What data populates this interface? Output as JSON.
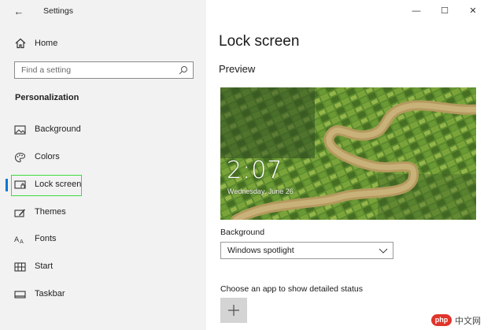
{
  "window": {
    "title": "Settings",
    "back_glyph": "←",
    "controls": {
      "minimize": "—",
      "maximize": "☐",
      "close": "✕"
    }
  },
  "sidebar": {
    "home_label": "Home",
    "search_placeholder": "Find a setting",
    "section_title": "Personalization",
    "items": [
      {
        "label": "Background",
        "icon": "picture-icon"
      },
      {
        "label": "Colors",
        "icon": "palette-icon"
      },
      {
        "label": "Lock screen",
        "icon": "lock-screen-icon",
        "active": true
      },
      {
        "label": "Themes",
        "icon": "brush-icon"
      },
      {
        "label": "Fonts",
        "icon": "fonts-icon"
      },
      {
        "label": "Start",
        "icon": "start-menu-icon"
      },
      {
        "label": "Taskbar",
        "icon": "taskbar-icon"
      }
    ]
  },
  "main": {
    "page_title": "Lock screen",
    "preview_title": "Preview",
    "preview": {
      "time": "2:07",
      "date": "Wednesday, June 26"
    },
    "background_label": "Background",
    "background_value": "Windows spotlight",
    "status_label": "Choose an app to show detailed status",
    "add_button_glyph": "+"
  },
  "watermark": {
    "badge": "php",
    "text": "中文网"
  },
  "colors": {
    "accent": "#0078d7",
    "highlight": "#3ddc3d",
    "sidebar_bg": "#f2f2f2"
  }
}
